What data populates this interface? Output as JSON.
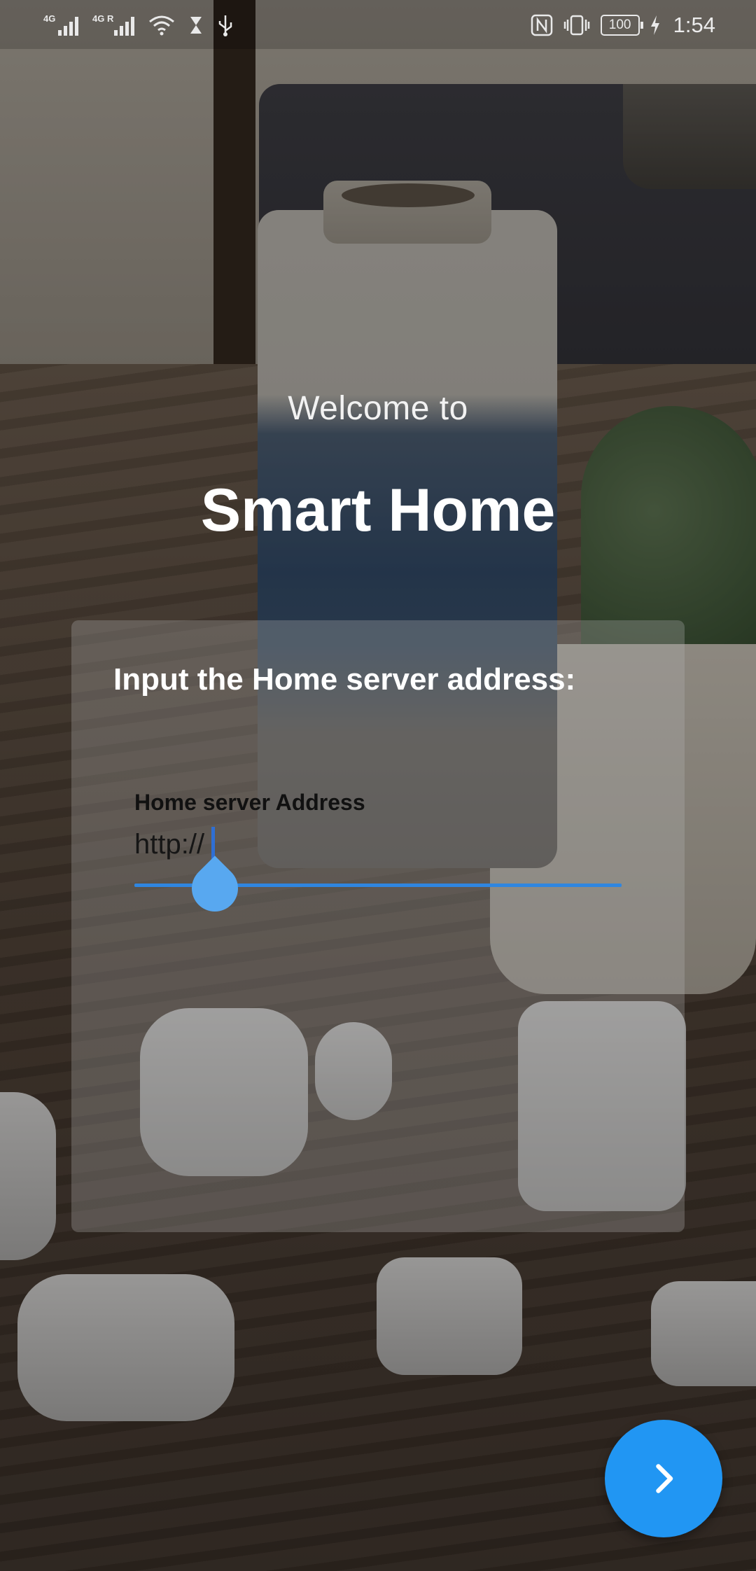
{
  "status_bar": {
    "network_1": "4G",
    "network_2": "4G R",
    "battery": "100",
    "time": "1:54",
    "icons": [
      "signal-icon",
      "signal-roaming-icon",
      "wifi-icon",
      "hourglass-icon",
      "usb-icon",
      "nfc-icon",
      "vibrate-icon",
      "battery-icon",
      "charging-icon"
    ]
  },
  "welcome": {
    "subtitle": "Welcome to",
    "title": "Smart Home"
  },
  "server_card": {
    "prompt": "Input the Home server address:",
    "field_label": "Home server Address",
    "field_value": "http://"
  },
  "fab": {
    "icon": "chevron-right-icon"
  },
  "colors": {
    "accent": "#2196f3",
    "input_underline": "#2f86e0",
    "cursor_handle": "#58a8f0"
  }
}
